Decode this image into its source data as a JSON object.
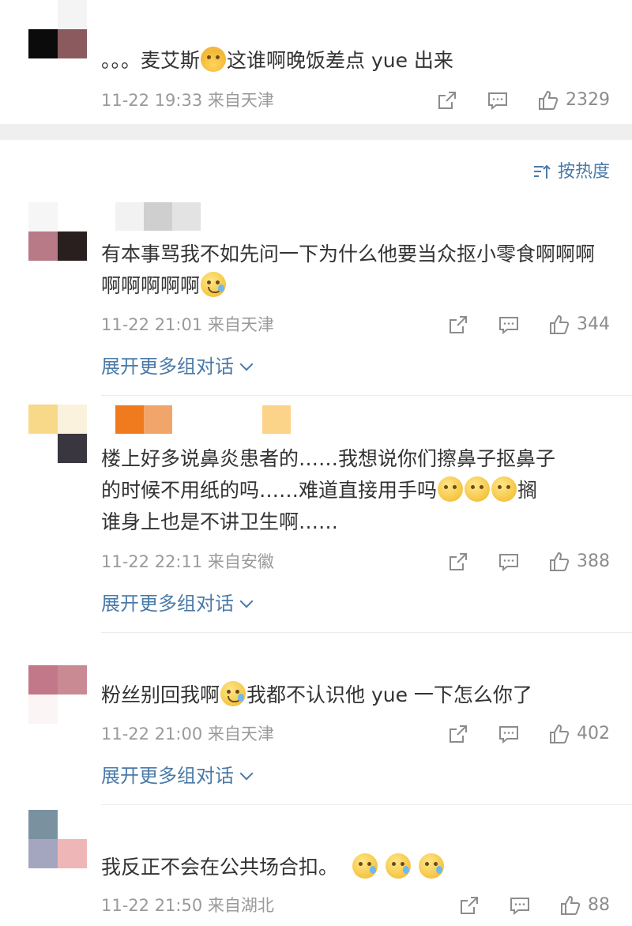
{
  "sort": {
    "label": "按热度",
    "icon": "sort-icon"
  },
  "comments": [
    {
      "text": "。。。麦艾斯",
      "text_after": "这谁啊晚饭差点 yue 出来",
      "emoji": "fearful-emoji",
      "time": "11-22 19:33 来自天津",
      "likes": "2329",
      "expand": ""
    },
    {
      "text": "有本事骂我不如先问一下为什么他要当众抠小零食啊啊啊啊啊啊啊啊",
      "emoji": "crying-laughing-emoji",
      "time": "11-22 21:01 来自天津",
      "likes": "344",
      "expand": "展开更多组对话"
    },
    {
      "text_line1": "楼上好多说鼻炎患者的……我想说你们擦鼻子抠鼻子",
      "text_line2": "的时候不用纸的吗……难道直接用手吗",
      "text_line2_end": "搁",
      "text_line3": "谁身上也是不讲卫生啊……",
      "emoji": "speechless-emoji",
      "time": "11-22 22:11 来自安徽",
      "likes": "388",
      "expand": "展开更多组对话"
    },
    {
      "text": "粉丝别回我啊",
      "text_after": "我都不认识他 yue 一下怎么你了",
      "emoji": "crying-laughing-emoji",
      "time": "11-22 21:00 来自天津",
      "likes": "402",
      "expand": "展开更多组对话"
    },
    {
      "text": "我反正不会在公共场合扣。",
      "emoji": "sweat-emoji",
      "time": "11-22 21:50 来自湖北",
      "likes": "88",
      "expand": ""
    }
  ],
  "colors": {
    "link": "#4a7aa8",
    "meta": "#9a9a9a",
    "text": "#333333",
    "band": "#efefef"
  }
}
